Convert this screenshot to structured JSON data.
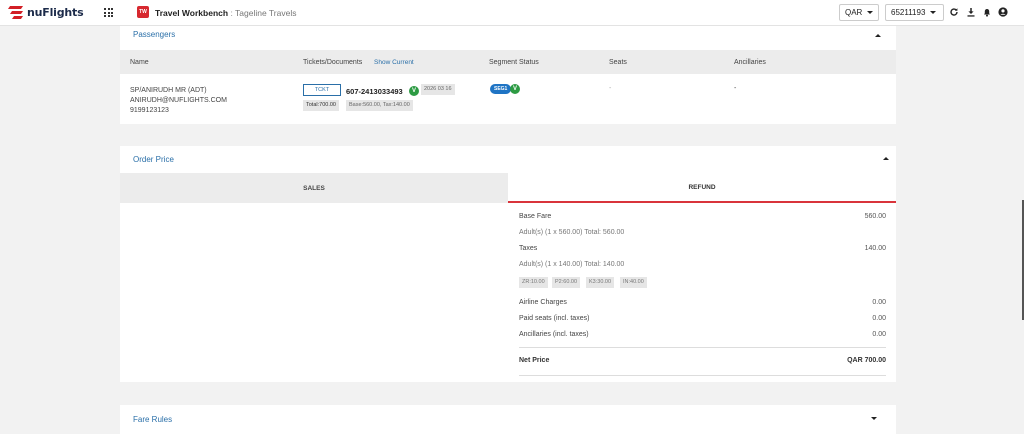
{
  "topbar": {
    "logo_text": "nuFlights",
    "app_badge": "TW",
    "app_name": "Travel Workbench",
    "separator": ":",
    "agency": "Tageline Travels",
    "currency": "QAR",
    "account": "65211193",
    "icons": [
      "grid-icon",
      "refresh-icon",
      "download-icon",
      "bell-icon",
      "user-icon"
    ]
  },
  "passengers": {
    "title": "Passengers",
    "columns": {
      "name": "Name",
      "tickets": "Tickets/Documents",
      "show_current": "Show Current",
      "segment_status": "Segment Status",
      "seats": "Seats",
      "ancillaries": "Ancillaries"
    },
    "row": {
      "name": "SP/ANIRUDH MR (ADT)",
      "email": "ANIRUDH@NUFLIGHTS.COM",
      "phone": "9199123123",
      "ticket_button": "TCKT",
      "ticket_number": "607-2413033493",
      "ticket_status": "V",
      "ticket_date": "2026 03 16",
      "total": "Total:700.00",
      "breakdown": "Base:560.00, Tax:140.00",
      "segment": "SEG1",
      "segment_status": "V",
      "seats": "-",
      "ancillaries": "-"
    }
  },
  "order_price": {
    "title": "Order Price",
    "tabs": {
      "sales": "SALES",
      "refund": "REFUND"
    },
    "base_fare_label": "Base Fare",
    "base_fare_value": "560.00",
    "base_fare_detail": "Adult(s) (1 x 560.00) Total: 560.00",
    "taxes_label": "Taxes",
    "taxes_value": "140.00",
    "taxes_detail": "Adult(s) (1 x 140.00) Total: 140.00",
    "tax_chips": [
      "ZR:10.00",
      "P2:60.00",
      "K3:30.00",
      "IN:40.00"
    ],
    "airline_charges_label": "Airline Charges",
    "airline_charges_value": "0.00",
    "paid_seats_label": "Paid seats (incl. taxes)",
    "paid_seats_value": "0.00",
    "ancillaries_label": "Ancillaries (incl. taxes)",
    "ancillaries_value": "0.00",
    "net_price_label": "Net Price",
    "net_price_value": "QAR 700.00"
  },
  "fare_rules": {
    "title": "Fare Rules"
  },
  "colors": {
    "brand_red": "#d21f26",
    "link_blue": "#2a6fa8",
    "status_green": "#2d9b43",
    "segment_blue": "#1f74c4"
  }
}
